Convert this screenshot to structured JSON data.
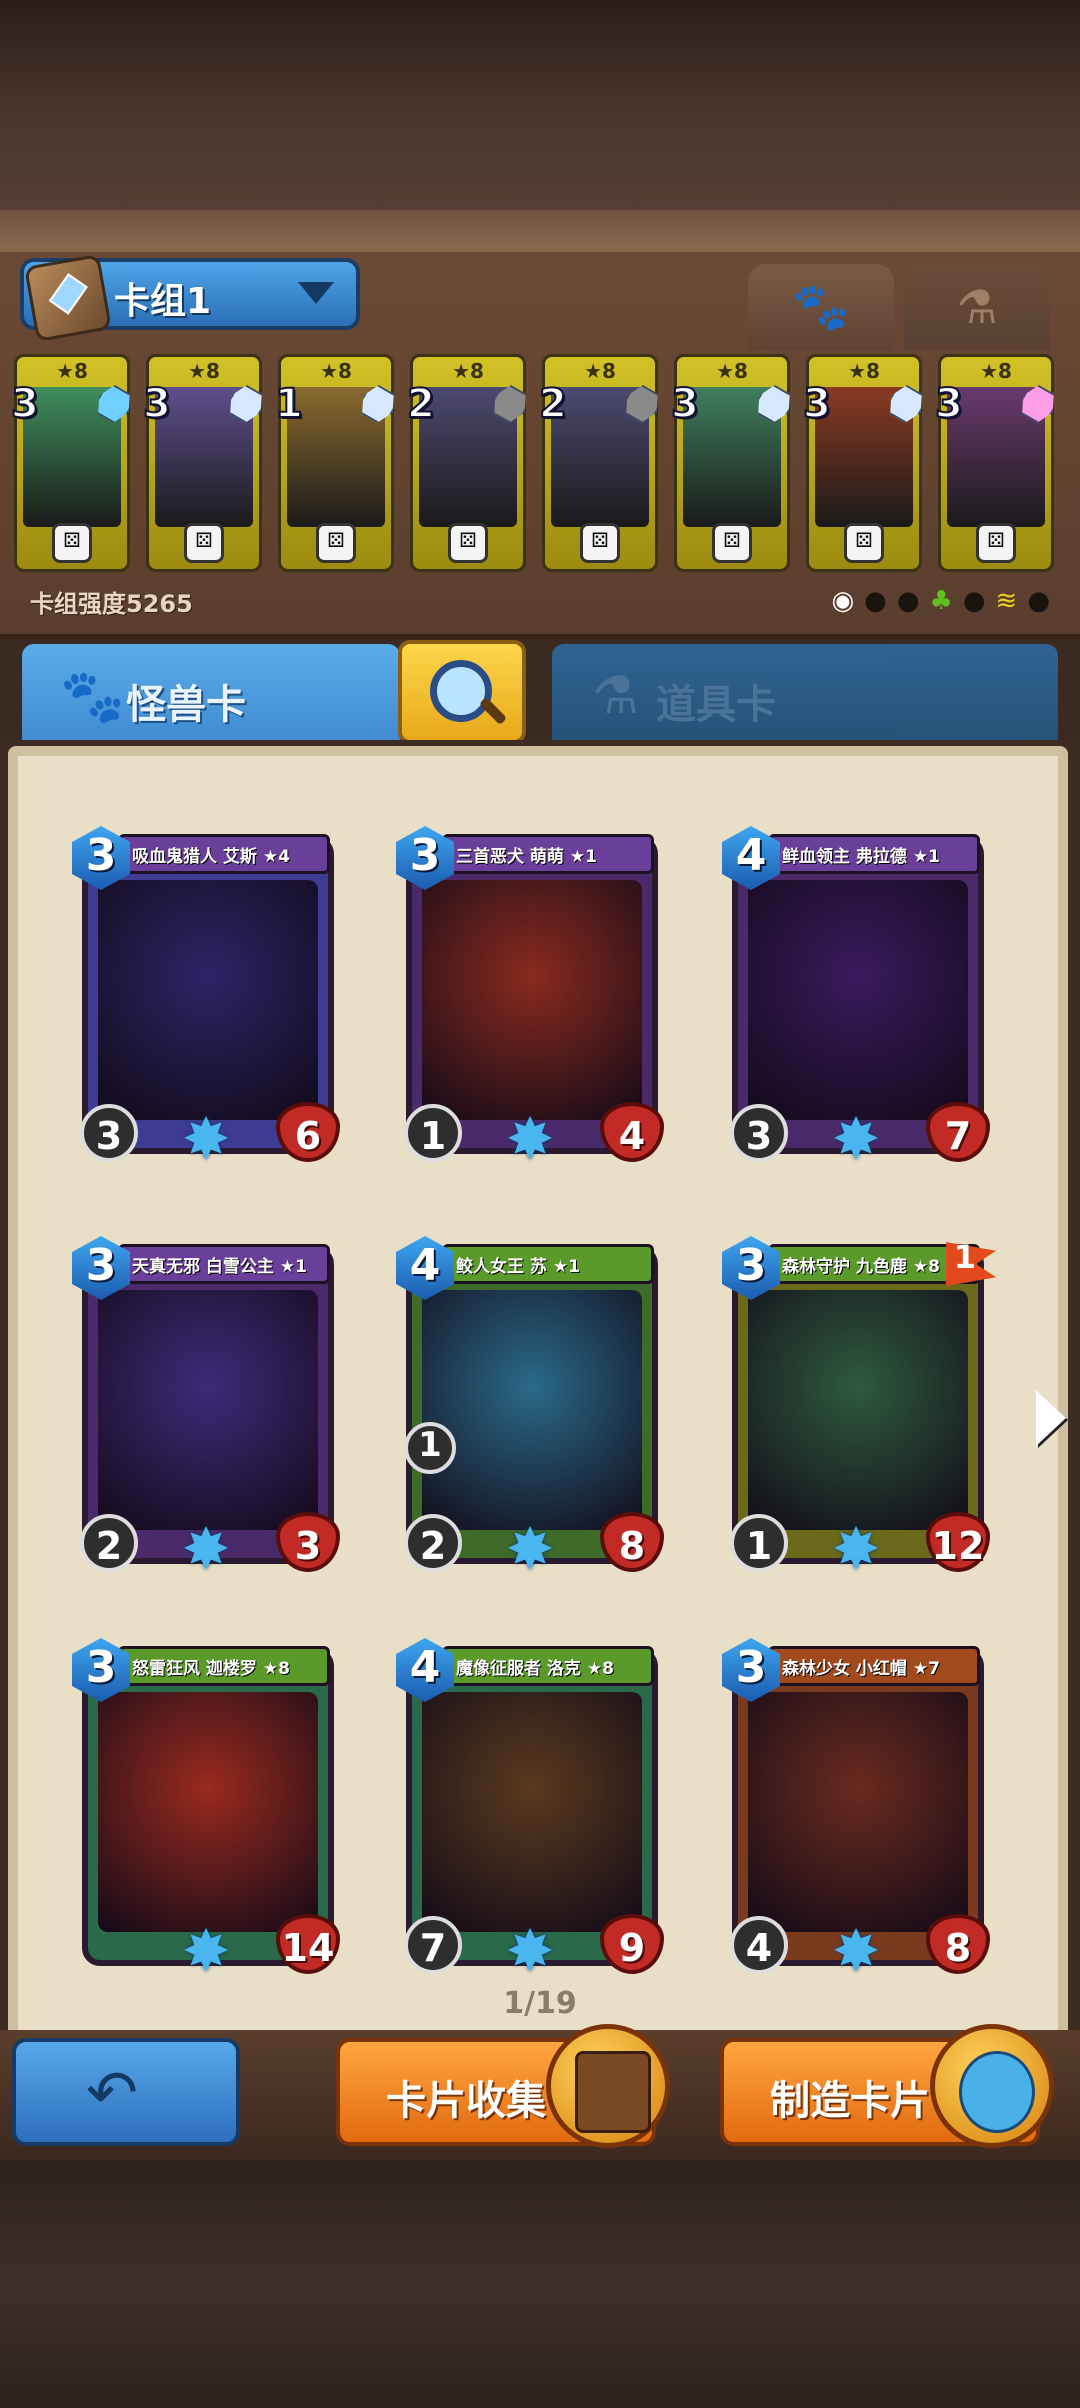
{
  "deck": {
    "name": "卡组1",
    "strength": "卡组强度5265",
    "cards": [
      {
        "cost": "3",
        "stars": "★8",
        "art": "#3f8f5e",
        "gem": "#6fd0ff"
      },
      {
        "cost": "3",
        "stars": "★8",
        "art": "#5f4f8e",
        "gem": "#d6e8ff"
      },
      {
        "cost": "1",
        "stars": "★8",
        "art": "#8a6a2e",
        "gem": "#d6e8ff"
      },
      {
        "cost": "2",
        "stars": "★8",
        "art": "#4d4a70",
        "gem": "#8a8a8a"
      },
      {
        "cost": "2",
        "stars": "★8",
        "art": "#4d4a70",
        "gem": "#8a8a8a"
      },
      {
        "cost": "3",
        "stars": "★8",
        "art": "#3f7f5e",
        "gem": "#d6e8ff"
      },
      {
        "cost": "3",
        "stars": "★8",
        "art": "#8a3a22",
        "gem": "#d6e8ff"
      },
      {
        "cost": "3",
        "stars": "★8",
        "art": "#6a3a6e",
        "gem": "#ff9ee8"
      }
    ]
  },
  "tabs": {
    "monsters": "怪兽卡",
    "items": "道具卡"
  },
  "cards": [
    {
      "name": "吸血鬼猎人 艾斯 ★4",
      "cost": "3",
      "attack": "3",
      "health": "6",
      "frame": "#3e3b92",
      "banner": "#6a3f9a",
      "art": "#2c2466"
    },
    {
      "name": "三首恶犬 萌萌 ★1",
      "cost": "3",
      "attack": "1",
      "health": "4",
      "frame": "#4a2a6a",
      "banner": "#6a3f9a",
      "art": "#8a2a1e"
    },
    {
      "name": "鲜血领主 弗拉德 ★1",
      "cost": "4",
      "attack": "3",
      "health": "7",
      "frame": "#4a2a6a",
      "banner": "#6a3f9a",
      "art": "#3a1a5e"
    },
    {
      "name": "天真无邪 白雪公主 ★1",
      "cost": "3",
      "attack": "2",
      "health": "3",
      "frame": "#4a2a6a",
      "banner": "#6a3f9a",
      "art": "#3e2a7a"
    },
    {
      "name": "鲛人女王 苏 ★1",
      "cost": "4",
      "attack": "2",
      "health": "8",
      "frame": "#3e6a2a",
      "banner": "#5a9a2a",
      "art": "#2a6a8a",
      "extra": "1"
    },
    {
      "name": "森林守护 九色鹿 ★8",
      "cost": "3",
      "attack": "1",
      "health": "12",
      "frame": "#6a6a1a",
      "banner": "#5a9a2a",
      "art": "#2e5a3e",
      "flag": "1"
    },
    {
      "name": "怒雷狂风 迦楼罗 ★8",
      "cost": "3",
      "attack": "",
      "health": "14",
      "frame": "#2a6a4a",
      "banner": "#5a9a2a",
      "art": "#9a2a1e"
    },
    {
      "name": "魔像征服者 洛克 ★8",
      "cost": "4",
      "attack": "7",
      "health": "9",
      "frame": "#2a6a4a",
      "banner": "#5a9a2a",
      "art": "#5a3a1e"
    },
    {
      "name": "森林少女 小红帽 ★7",
      "cost": "3",
      "attack": "4",
      "health": "8",
      "frame": "#7a3a1e",
      "banner": "#a04a1e",
      "art": "#6a2a1e"
    }
  ],
  "pagination": "1/19",
  "buttons": {
    "collection": "卡片收集",
    "craft": "制造卡片"
  },
  "icons": {
    "back": "back-arrow-icon",
    "search": "search-icon",
    "paw": "paw-icon",
    "flask": "flask-icon",
    "next": "next-page-icon"
  },
  "colors": {
    "blue_button": "#2d6fbd",
    "orange_button": "#e26a10",
    "page": "#e9dfc7"
  }
}
